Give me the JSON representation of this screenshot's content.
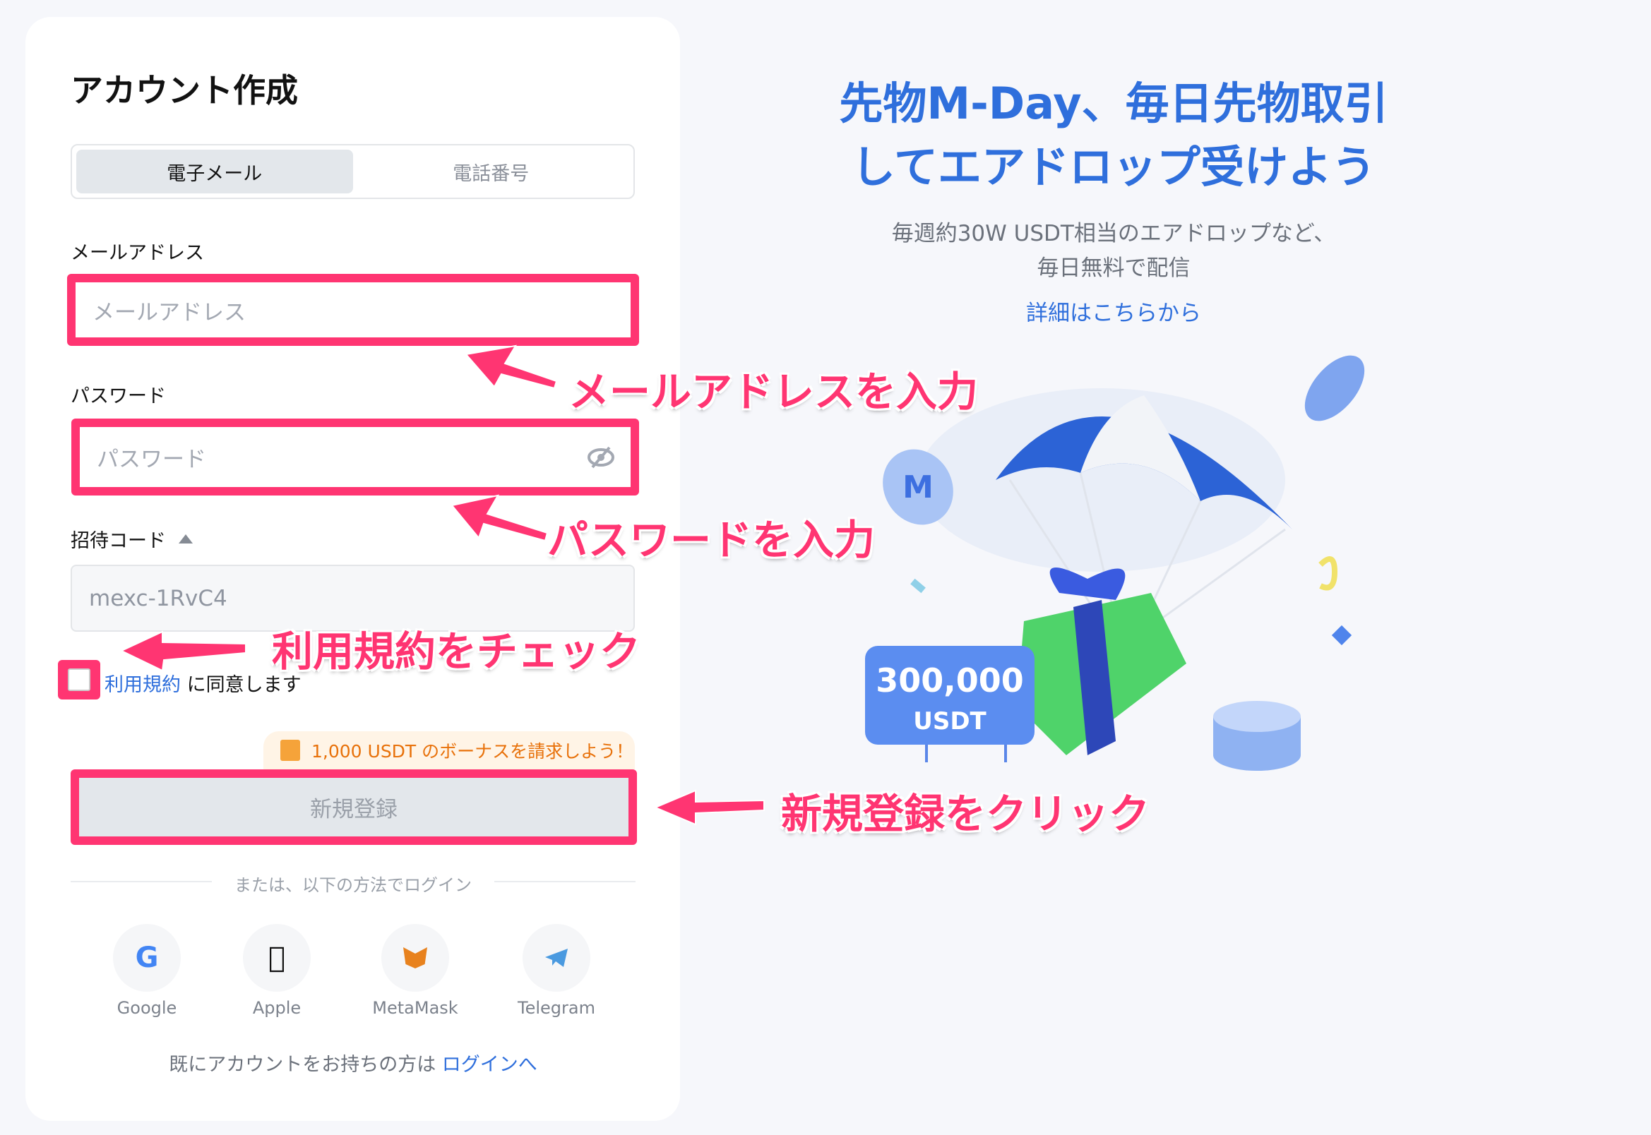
{
  "form": {
    "title": "アカウント作成",
    "tabs": [
      {
        "label": "電子メール",
        "active": true
      },
      {
        "label": "電話番号",
        "active": false
      }
    ],
    "email_label": "メールアドレス",
    "email_placeholder": "メールアドレス",
    "password_label": "パスワード",
    "password_placeholder": "パスワード",
    "invite_label": "招待コード",
    "invite_value": "mexc-1RvC4",
    "terms_link": "利用規約",
    "terms_text": "に同意します",
    "terms_checked": false,
    "bonus_text": "1,000 USDT のボーナスを請求しよう！",
    "register_button": "新規登録",
    "divider_text": "または、以下の方法でログイン",
    "social": [
      {
        "label": "Google",
        "icon": "google-icon"
      },
      {
        "label": "Apple",
        "icon": "apple-icon"
      },
      {
        "label": "MetaMask",
        "icon": "metamask-icon"
      },
      {
        "label": "Telegram",
        "icon": "telegram-icon"
      }
    ],
    "login_prompt": "既にアカウントをお持ちの方は",
    "login_link": "ログインへ"
  },
  "promo": {
    "headline_1": "先物M-Day、毎日先物取引",
    "headline_2": "してエアドロップ受けよう",
    "sub_1": "毎週約30W USDT相当のエアドロップなど、",
    "sub_2": "毎日無料で配信",
    "details_link": "詳細はこちらから",
    "sign_amount": "300,000",
    "sign_unit": "USDT"
  },
  "annotations": {
    "email": "メールアドレスを入力",
    "password": "パスワードを入力",
    "terms": "利用規約をチェック",
    "register": "新規登録をクリック"
  },
  "colors": {
    "accent": "#2f6fdc",
    "highlight": "#ff3572",
    "bonus": "#e8710a"
  }
}
